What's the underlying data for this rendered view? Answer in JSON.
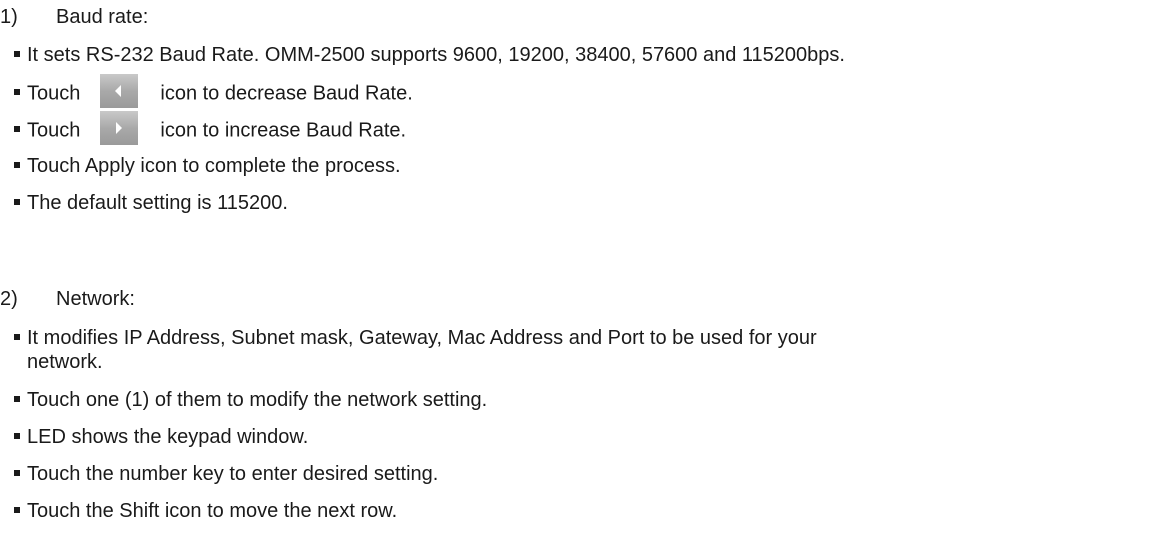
{
  "section1": {
    "number": "1)",
    "title": "Baud rate:",
    "bullet1": "It sets RS-232 Baud Rate. OMM-2500 supports 9600, 19200, 38400, 57600 and 115200bps.",
    "bullet2_before": "Touch",
    "bullet2_icon": "left-arrow-icon",
    "bullet2_after": "icon to decrease Baud Rate.",
    "bullet3_before": "Touch",
    "bullet3_icon": "right-arrow-icon",
    "bullet3_after": "icon to increase Baud Rate.",
    "bullet4": "Touch Apply icon to complete the process.",
    "bullet5": "The default setting is 115200."
  },
  "section2": {
    "number": "2)",
    "title": "Network:",
    "bullet1_line1": "It modifies IP Address, Subnet mask, Gateway, Mac Address and Port to be used for your",
    "bullet1_line2": "network.",
    "bullet2": "Touch one (1) of them to modify the network setting.",
    "bullet3": "LED shows the keypad window.",
    "bullet4": "Touch the number key to enter desired setting.",
    "bullet5": "Touch the Shift icon to move the next row."
  }
}
